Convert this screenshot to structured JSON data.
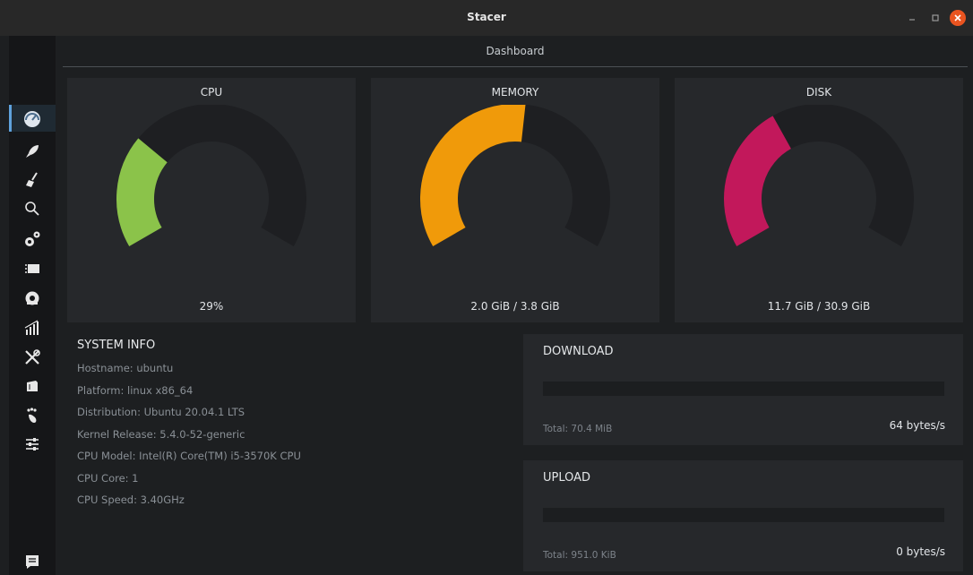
{
  "window": {
    "title": "Stacer"
  },
  "header": {
    "title": "Dashboard"
  },
  "sidebar": {
    "items": [
      {
        "icon": "dashboard-gauge-icon",
        "active": true
      },
      {
        "icon": "rocket-icon"
      },
      {
        "icon": "broom-icon"
      },
      {
        "icon": "search-icon"
      },
      {
        "icon": "gears-icon"
      },
      {
        "icon": "processes-icon"
      },
      {
        "icon": "package-icon"
      },
      {
        "icon": "resources-chart-icon"
      },
      {
        "icon": "tools-icon"
      },
      {
        "icon": "apt-box-icon"
      },
      {
        "icon": "gnome-foot-icon"
      },
      {
        "icon": "settings-sliders-icon"
      }
    ],
    "footer_icon": "feedback-icon"
  },
  "gauges": [
    {
      "title": "CPU",
      "value_text": "29%",
      "fraction": 0.29,
      "color": "#8bc34a",
      "color2": "#a2d149"
    },
    {
      "title": "MEMORY",
      "value_text": "2.0 GiB / 3.8 GiB",
      "fraction": 0.526,
      "color": "#f09a0a",
      "color2": "#f5a623"
    },
    {
      "title": "DISK",
      "value_text": "11.7 GiB / 30.9 GiB",
      "fraction": 0.379,
      "color": "#c2185b",
      "color2": "#d23d72"
    }
  ],
  "system_info": {
    "heading": "SYSTEM INFO",
    "rows": [
      "Hostname: ubuntu",
      "Platform: linux x86_64",
      "Distribution: Ubuntu 20.04.1 LTS",
      "Kernel Release: 5.4.0-52-generic",
      "CPU Model: Intel(R) Core(TM) i5-3570K CPU",
      "CPU Core: 1",
      "CPU Speed: 3.40GHz"
    ]
  },
  "network": {
    "download": {
      "title": "DOWNLOAD",
      "total": "Total: 70.4 MiB",
      "rate": "64 bytes/s"
    },
    "upload": {
      "title": "UPLOAD",
      "total": "Total: 951.0 KiB",
      "rate": "0 bytes/s"
    }
  },
  "colors": {
    "track": "#1e1f22",
    "accent": "#5fa2dd",
    "close": "#e95420"
  }
}
